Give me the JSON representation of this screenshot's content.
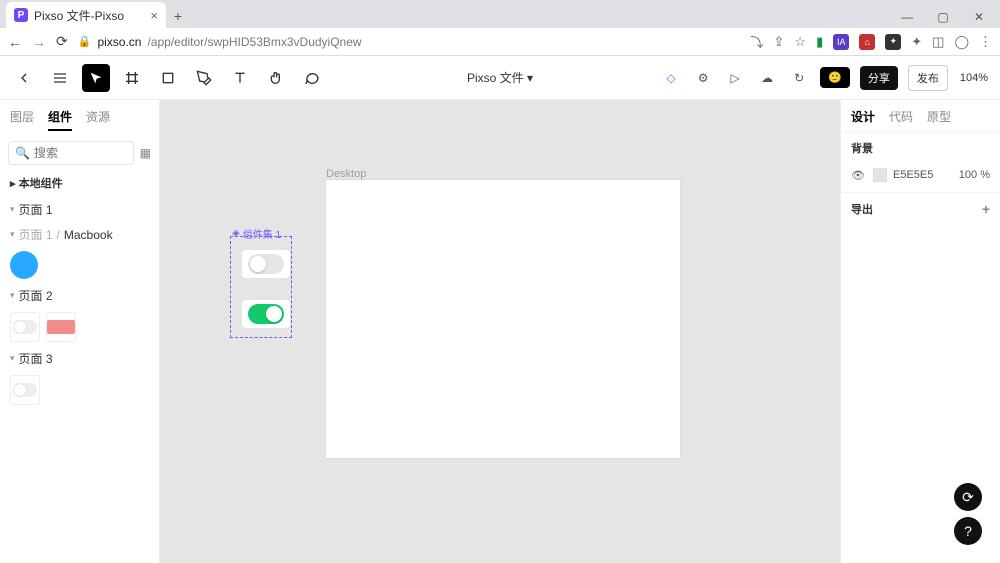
{
  "browser": {
    "tab_title": "Pixso 文件-Pixso",
    "url_host": "pixso.cn",
    "url_path": "/app/editor/swpHID53Bmx3vDudyiQnew"
  },
  "toolbar": {
    "doc_title": "Pixso 文件 ▾",
    "share": "分享",
    "publish": "发布",
    "zoom": "104%"
  },
  "left": {
    "tabs": {
      "layers": "图层",
      "components": "组件",
      "resources": "资源"
    },
    "search_placeholder": "搜索",
    "local_components": "本地组件",
    "page1": "页面 1",
    "page1_sub": "页面 1",
    "page1_macbook": "Macbook",
    "page2": "页面 2",
    "page3": "页面 3"
  },
  "canvas": {
    "frame_label": "Desktop",
    "selection_label": "组件集 1"
  },
  "right": {
    "tabs": {
      "design": "设计",
      "code": "代码",
      "prototype": "原型"
    },
    "background_section": "背景",
    "background_value": "E5E5E5",
    "background_opacity": "100 %",
    "export_section": "导出"
  }
}
